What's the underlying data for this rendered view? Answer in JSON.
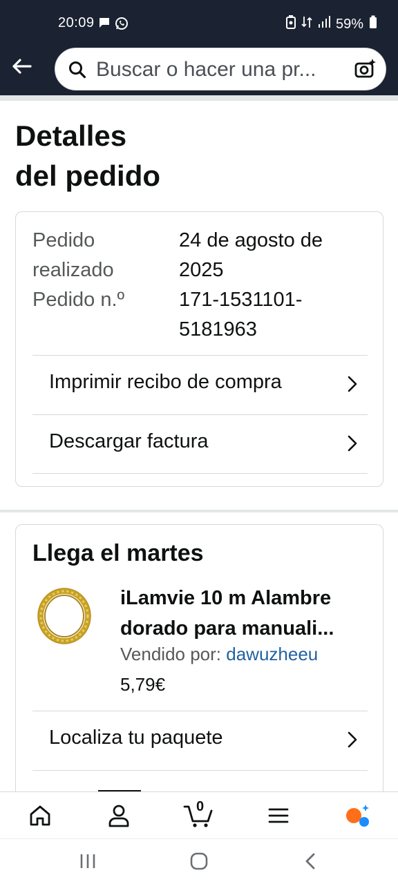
{
  "status_bar": {
    "time": "20:09",
    "battery": "59%"
  },
  "search": {
    "placeholder": "Buscar o hacer una pr..."
  },
  "page": {
    "title_line1": "Detalles",
    "title_line2": "del pedido"
  },
  "order_info": {
    "placed_label_line1": "Pedido",
    "placed_label_line2": "realizado",
    "placed_value_line1": "24 de agosto de",
    "placed_value_line2": "2025",
    "number_label": "Pedido n.º",
    "number_value_line1": "171-1531101-",
    "number_value_line2": "5181963",
    "actions": [
      {
        "label": "Imprimir recibo de compra"
      },
      {
        "label": "Descargar factura"
      }
    ]
  },
  "delivery": {
    "title": "Llega el martes",
    "product_name": "iLamvie 10 m Alambre dorado para manuali...",
    "sold_by_label": "Vendido por:",
    "seller": "dawuzheeu",
    "price": "5,79€",
    "track_label": "Localiza tu paquete"
  },
  "bottom_nav": {
    "cart_count": "0",
    "items": [
      "home-icon",
      "account-icon",
      "cart-icon",
      "menu-icon",
      "rufus-ai-icon"
    ]
  },
  "colors": {
    "header_bg": "#1b2231",
    "link": "#2162a1",
    "ai_orange": "#ff6f1a",
    "ai_blue": "#1a8cff"
  }
}
